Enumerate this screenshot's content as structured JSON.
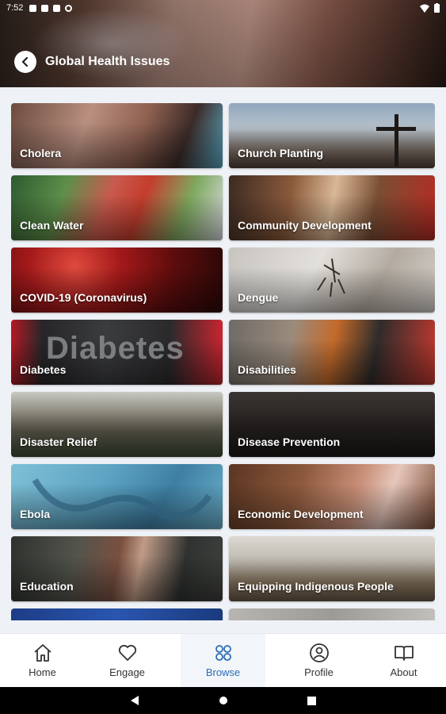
{
  "status_bar": {
    "time": "7:52"
  },
  "header": {
    "title": "Global Health Issues"
  },
  "categories": [
    {
      "label": "Cholera"
    },
    {
      "label": "Church Planting"
    },
    {
      "label": "Clean Water"
    },
    {
      "label": "Community Development"
    },
    {
      "label": "COVID-19 (Coronavirus)"
    },
    {
      "label": "Dengue"
    },
    {
      "label": "Diabetes"
    },
    {
      "label": "Disabilities"
    },
    {
      "label": "Disaster Relief"
    },
    {
      "label": "Disease Prevention"
    },
    {
      "label": "Ebola"
    },
    {
      "label": "Economic Development"
    },
    {
      "label": "Education"
    },
    {
      "label": "Equipping Indigenous People"
    }
  ],
  "bottom_nav": {
    "items": [
      {
        "label": "Home",
        "icon": "home-icon"
      },
      {
        "label": "Engage",
        "icon": "heart-icon"
      },
      {
        "label": "Browse",
        "icon": "grid-icon",
        "active": true
      },
      {
        "label": "Profile",
        "icon": "profile-icon"
      },
      {
        "label": "About",
        "icon": "book-icon"
      }
    ]
  },
  "colors": {
    "accent": "#2a6db5"
  }
}
